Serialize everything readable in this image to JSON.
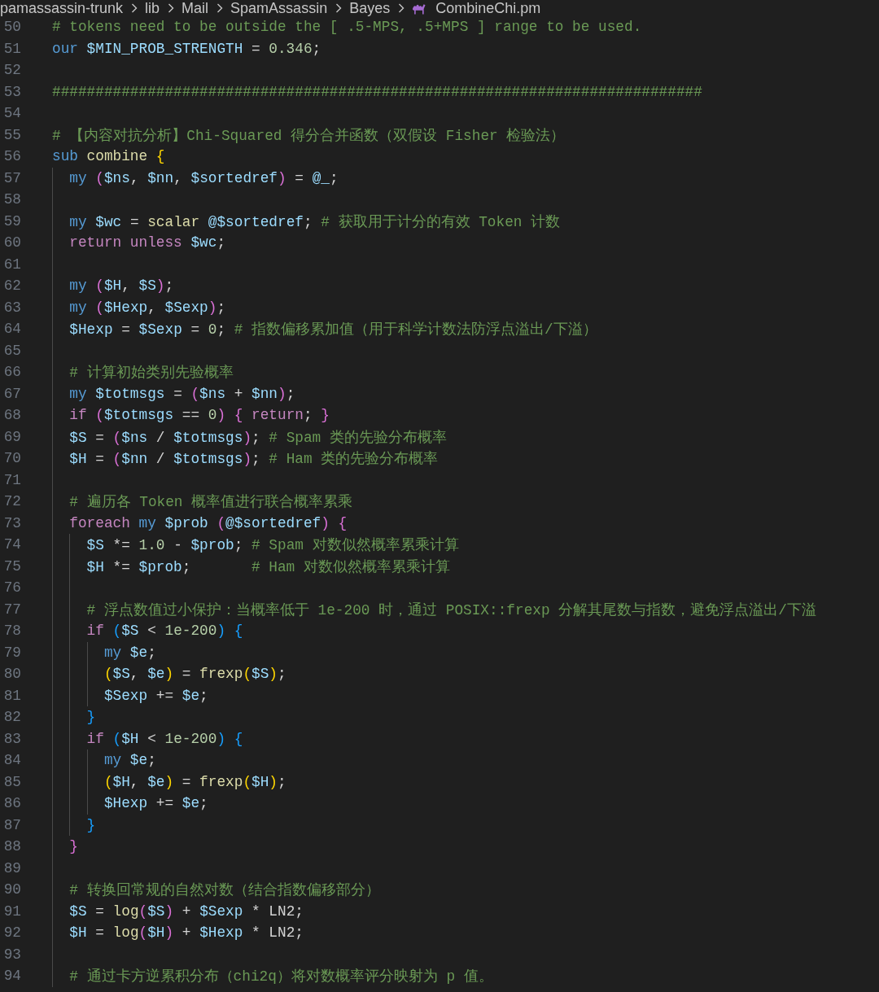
{
  "breadcrumb": [
    {
      "label": "pamassassin-trunk",
      "kind": "folder"
    },
    {
      "label": "lib",
      "kind": "folder"
    },
    {
      "label": "Mail",
      "kind": "folder"
    },
    {
      "label": "SpamAssassin",
      "kind": "folder"
    },
    {
      "label": "Bayes",
      "kind": "folder"
    },
    {
      "label": "CombineChi.pm",
      "kind": "file"
    }
  ],
  "lines": [
    {
      "number": "50",
      "tokens": [
        {
          "kind": "comment",
          "text": "# tokens need to be outside the [ .5-MPS, .5+MPS ] range to be used."
        }
      ]
    },
    {
      "number": "51",
      "tokens": [
        {
          "kind": "keyword",
          "text": "our "
        },
        {
          "kind": "variable",
          "text": "$MIN_PROB_STRENGTH"
        },
        {
          "kind": "plain",
          "text": " = "
        },
        {
          "kind": "number",
          "text": "0.346"
        },
        {
          "kind": "plain",
          "text": ";"
        }
      ]
    },
    {
      "number": "52"
    },
    {
      "number": "53",
      "tokens": [
        {
          "kind": "comment",
          "text": "###########################################################################"
        }
      ]
    },
    {
      "number": "54"
    },
    {
      "number": "55",
      "tokens": [
        {
          "kind": "comment",
          "text": "# 【内容对抗分析】Chi-Squared 得分合并函数（双假设 Fisher 检验法）"
        }
      ]
    },
    {
      "number": "56",
      "tokens": [
        {
          "kind": "keyword",
          "text": "sub "
        },
        {
          "kind": "function",
          "text": "combine "
        },
        {
          "kind": "open",
          "text": "{"
        }
      ],
      "children": [
        {
          "number": "57",
          "tokens": [
            {
              "kind": "keyword",
              "text": "my "
            },
            {
              "kind": "open",
              "text": "("
            },
            {
              "kind": "variable",
              "text": "$ns"
            },
            {
              "kind": "plain",
              "text": ", "
            },
            {
              "kind": "variable",
              "text": "$nn"
            },
            {
              "kind": "plain",
              "text": ", "
            },
            {
              "kind": "variable",
              "text": "$sortedref"
            },
            {
              "kind": "close",
              "text": ")"
            },
            {
              "kind": "plain",
              "text": " = "
            },
            {
              "kind": "variable",
              "text": "@_"
            },
            {
              "kind": "plain",
              "text": ";"
            }
          ]
        },
        {
          "number": "58"
        },
        {
          "number": "59",
          "tokens": [
            {
              "kind": "keyword",
              "text": "my "
            },
            {
              "kind": "variable",
              "text": "$wc"
            },
            {
              "kind": "plain",
              "text": " = "
            },
            {
              "kind": "function",
              "text": "scalar "
            },
            {
              "kind": "variable",
              "text": "@$sortedref"
            },
            {
              "kind": "plain",
              "text": "; "
            },
            {
              "kind": "comment",
              "text": "# 获取用于计分的有效 Token 计数"
            }
          ]
        },
        {
          "number": "60",
          "tokens": [
            {
              "kind": "control",
              "text": "return "
            },
            {
              "kind": "control",
              "text": "unless "
            },
            {
              "kind": "variable",
              "text": "$wc"
            },
            {
              "kind": "plain",
              "text": ";"
            }
          ]
        },
        {
          "number": "61"
        },
        {
          "number": "62",
          "tokens": [
            {
              "kind": "keyword",
              "text": "my "
            },
            {
              "kind": "open",
              "text": "("
            },
            {
              "kind": "variable",
              "text": "$H"
            },
            {
              "kind": "plain",
              "text": ", "
            },
            {
              "kind": "variable",
              "text": "$S"
            },
            {
              "kind": "close",
              "text": ")"
            },
            {
              "kind": "plain",
              "text": ";"
            }
          ]
        },
        {
          "number": "63",
          "tokens": [
            {
              "kind": "keyword",
              "text": "my "
            },
            {
              "kind": "open",
              "text": "("
            },
            {
              "kind": "variable",
              "text": "$Hexp"
            },
            {
              "kind": "plain",
              "text": ", "
            },
            {
              "kind": "variable",
              "text": "$Sexp"
            },
            {
              "kind": "close",
              "text": ")"
            },
            {
              "kind": "plain",
              "text": ";"
            }
          ]
        },
        {
          "number": "64",
          "tokens": [
            {
              "kind": "variable",
              "text": "$Hexp"
            },
            {
              "kind": "plain",
              "text": " = "
            },
            {
              "kind": "variable",
              "text": "$Sexp"
            },
            {
              "kind": "plain",
              "text": " = "
            },
            {
              "kind": "number",
              "text": "0"
            },
            {
              "kind": "plain",
              "text": "; "
            },
            {
              "kind": "comment",
              "text": "# 指数偏移累加值（用于科学计数法防浮点溢出/下溢）"
            }
          ]
        },
        {
          "number": "65"
        },
        {
          "number": "66",
          "tokens": [
            {
              "kind": "comment",
              "text": "# 计算初始类别先验概率"
            }
          ]
        },
        {
          "number": "67",
          "tokens": [
            {
              "kind": "keyword",
              "text": "my "
            },
            {
              "kind": "variable",
              "text": "$totmsgs"
            },
            {
              "kind": "plain",
              "text": " = "
            },
            {
              "kind": "open",
              "text": "("
            },
            {
              "kind": "variable",
              "text": "$ns"
            },
            {
              "kind": "plain",
              "text": " + "
            },
            {
              "kind": "variable",
              "text": "$nn"
            },
            {
              "kind": "close",
              "text": ")"
            },
            {
              "kind": "plain",
              "text": ";"
            }
          ]
        },
        {
          "number": "68",
          "tokens": [
            {
              "kind": "control",
              "text": "if "
            },
            {
              "kind": "open",
              "text": "("
            },
            {
              "kind": "variable",
              "text": "$totmsgs"
            },
            {
              "kind": "plain",
              "text": " == "
            },
            {
              "kind": "number",
              "text": "0"
            },
            {
              "kind": "close",
              "text": ")"
            },
            {
              "kind": "open",
              "text": " {"
            },
            {
              "kind": "control",
              "text": " return"
            },
            {
              "kind": "plain",
              "text": "; "
            },
            {
              "kind": "close",
              "text": "}"
            }
          ]
        },
        {
          "number": "69",
          "tokens": [
            {
              "kind": "variable",
              "text": "$S"
            },
            {
              "kind": "plain",
              "text": " = "
            },
            {
              "kind": "open",
              "text": "("
            },
            {
              "kind": "variable",
              "text": "$ns"
            },
            {
              "kind": "plain",
              "text": " / "
            },
            {
              "kind": "variable",
              "text": "$totmsgs"
            },
            {
              "kind": "close",
              "text": ")"
            },
            {
              "kind": "plain",
              "text": "; "
            },
            {
              "kind": "comment",
              "text": "# Spam 类的先验分布概率"
            }
          ]
        },
        {
          "number": "70",
          "tokens": [
            {
              "kind": "variable",
              "text": "$H"
            },
            {
              "kind": "plain",
              "text": " = "
            },
            {
              "kind": "open",
              "text": "("
            },
            {
              "kind": "variable",
              "text": "$nn"
            },
            {
              "kind": "plain",
              "text": " / "
            },
            {
              "kind": "variable",
              "text": "$totmsgs"
            },
            {
              "kind": "close",
              "text": ")"
            },
            {
              "kind": "plain",
              "text": "; "
            },
            {
              "kind": "comment",
              "text": "# Ham 类的先验分布概率"
            }
          ]
        },
        {
          "number": "71"
        },
        {
          "number": "72",
          "tokens": [
            {
              "kind": "comment",
              "text": "# 遍历各 Token 概率值进行联合概率累乘"
            }
          ]
        },
        {
          "number": "73",
          "tokens": [
            {
              "kind": "control",
              "text": "foreach "
            },
            {
              "kind": "keyword",
              "text": "my "
            },
            {
              "kind": "variable",
              "text": "$prob "
            },
            {
              "kind": "open",
              "text": "("
            },
            {
              "kind": "variable",
              "text": "@$sortedref"
            },
            {
              "kind": "close",
              "text": ")"
            },
            {
              "kind": "open",
              "text": " {"
            }
          ],
          "children": [
            {
              "number": "74",
              "tokens": [
                {
                  "kind": "variable",
                  "text": "$S"
                },
                {
                  "kind": "plain",
                  "text": " *= "
                },
                {
                  "kind": "number",
                  "text": "1.0"
                },
                {
                  "kind": "plain",
                  "text": " - "
                },
                {
                  "kind": "variable",
                  "text": "$prob"
                },
                {
                  "kind": "plain",
                  "text": "; "
                },
                {
                  "kind": "comment",
                  "text": "# Spam 对数似然概率累乘计算"
                }
              ]
            },
            {
              "number": "75",
              "tokens": [
                {
                  "kind": "variable",
                  "text": "$H"
                },
                {
                  "kind": "plain",
                  "text": " *= "
                },
                {
                  "kind": "variable",
                  "text": "$prob"
                },
                {
                  "kind": "plain",
                  "text": ";       "
                },
                {
                  "kind": "comment",
                  "text": "# Ham 对数似然概率累乘计算"
                }
              ]
            },
            {
              "number": "76"
            },
            {
              "number": "77",
              "tokens": [
                {
                  "kind": "comment",
                  "text": "# 浮点数值过小保护：当概率低于 1e-200 时，通过 POSIX::frexp 分解其尾数与指数，避免浮点溢出/下溢"
                }
              ]
            },
            {
              "number": "78",
              "tokens": [
                {
                  "kind": "control",
                  "text": "if "
                },
                {
                  "kind": "open",
                  "text": "("
                },
                {
                  "kind": "variable",
                  "text": "$S"
                },
                {
                  "kind": "plain",
                  "text": " < "
                },
                {
                  "kind": "number",
                  "text": "1e-200"
                },
                {
                  "kind": "close",
                  "text": ")"
                },
                {
                  "kind": "open",
                  "text": " {"
                }
              ],
              "children": [
                {
                  "number": "79",
                  "tokens": [
                    {
                      "kind": "keyword",
                      "text": "my "
                    },
                    {
                      "kind": "variable",
                      "text": "$e"
                    },
                    {
                      "kind": "plain",
                      "text": ";"
                    }
                  ]
                },
                {
                  "number": "80",
                  "tokens": [
                    {
                      "kind": "open",
                      "text": "("
                    },
                    {
                      "kind": "variable",
                      "text": "$S"
                    },
                    {
                      "kind": "plain",
                      "text": ", "
                    },
                    {
                      "kind": "variable",
                      "text": "$e"
                    },
                    {
                      "kind": "close",
                      "text": ")"
                    },
                    {
                      "kind": "plain",
                      "text": " = "
                    },
                    {
                      "kind": "function",
                      "text": "frexp"
                    },
                    {
                      "kind": "open",
                      "text": "("
                    },
                    {
                      "kind": "variable",
                      "text": "$S"
                    },
                    {
                      "kind": "close",
                      "text": ")"
                    },
                    {
                      "kind": "plain",
                      "text": ";"
                    }
                  ]
                },
                {
                  "number": "81",
                  "tokens": [
                    {
                      "kind": "variable",
                      "text": "$Sexp"
                    },
                    {
                      "kind": "plain",
                      "text": " += "
                    },
                    {
                      "kind": "variable",
                      "text": "$e"
                    },
                    {
                      "kind": "plain",
                      "text": ";"
                    }
                  ]
                }
              ]
            },
            {
              "number": "82",
              "tokens": [
                {
                  "kind": "close",
                  "text": "}"
                }
              ]
            },
            {
              "number": "83",
              "tokens": [
                {
                  "kind": "control",
                  "text": "if "
                },
                {
                  "kind": "open",
                  "text": "("
                },
                {
                  "kind": "variable",
                  "text": "$H"
                },
                {
                  "kind": "plain",
                  "text": " < "
                },
                {
                  "kind": "number",
                  "text": "1e-200"
                },
                {
                  "kind": "close",
                  "text": ")"
                },
                {
                  "kind": "open",
                  "text": " {"
                }
              ],
              "children": [
                {
                  "number": "84",
                  "tokens": [
                    {
                      "kind": "keyword",
                      "text": "my "
                    },
                    {
                      "kind": "variable",
                      "text": "$e"
                    },
                    {
                      "kind": "plain",
                      "text": ";"
                    }
                  ]
                },
                {
                  "number": "85",
                  "tokens": [
                    {
                      "kind": "open",
                      "text": "("
                    },
                    {
                      "kind": "variable",
                      "text": "$H"
                    },
                    {
                      "kind": "plain",
                      "text": ", "
                    },
                    {
                      "kind": "variable",
                      "text": "$e"
                    },
                    {
                      "kind": "close",
                      "text": ")"
                    },
                    {
                      "kind": "plain",
                      "text": " = "
                    },
                    {
                      "kind": "function",
                      "text": "frexp"
                    },
                    {
                      "kind": "open",
                      "text": "("
                    },
                    {
                      "kind": "variable",
                      "text": "$H"
                    },
                    {
                      "kind": "close",
                      "text": ")"
                    },
                    {
                      "kind": "plain",
                      "text": ";"
                    }
                  ]
                },
                {
                  "number": "86",
                  "tokens": [
                    {
                      "kind": "variable",
                      "text": "$Hexp"
                    },
                    {
                      "kind": "plain",
                      "text": " += "
                    },
                    {
                      "kind": "variable",
                      "text": "$e"
                    },
                    {
                      "kind": "plain",
                      "text": ";"
                    }
                  ]
                }
              ]
            },
            {
              "number": "87",
              "tokens": [
                {
                  "kind": "close",
                  "text": "}"
                }
              ]
            }
          ]
        },
        {
          "number": "88",
          "tokens": [
            {
              "kind": "close",
              "text": "}"
            }
          ]
        },
        {
          "number": "89"
        },
        {
          "number": "90",
          "tokens": [
            {
              "kind": "comment",
              "text": "# 转换回常规的自然对数（结合指数偏移部分）"
            }
          ]
        },
        {
          "number": "91",
          "tokens": [
            {
              "kind": "variable",
              "text": "$S"
            },
            {
              "kind": "plain",
              "text": " = "
            },
            {
              "kind": "function",
              "text": "log"
            },
            {
              "kind": "open",
              "text": "("
            },
            {
              "kind": "variable",
              "text": "$S"
            },
            {
              "kind": "close",
              "text": ")"
            },
            {
              "kind": "plain",
              "text": " + "
            },
            {
              "kind": "variable",
              "text": "$Sexp"
            },
            {
              "kind": "plain",
              "text": " * LN2;"
            }
          ]
        },
        {
          "number": "92",
          "tokens": [
            {
              "kind": "variable",
              "text": "$H"
            },
            {
              "kind": "plain",
              "text": " = "
            },
            {
              "kind": "function",
              "text": "log"
            },
            {
              "kind": "open",
              "text": "("
            },
            {
              "kind": "variable",
              "text": "$H"
            },
            {
              "kind": "close",
              "text": ")"
            },
            {
              "kind": "plain",
              "text": " + "
            },
            {
              "kind": "variable",
              "text": "$Hexp"
            },
            {
              "kind": "plain",
              "text": " * LN2;"
            }
          ]
        },
        {
          "number": "93"
        },
        {
          "number": "94",
          "tokens": [
            {
              "kind": "comment",
              "text": "# 通过卡方逆累积分布（chi2q）将对数概率评分映射为 p 值。"
            }
          ]
        }
      ]
    }
  ]
}
